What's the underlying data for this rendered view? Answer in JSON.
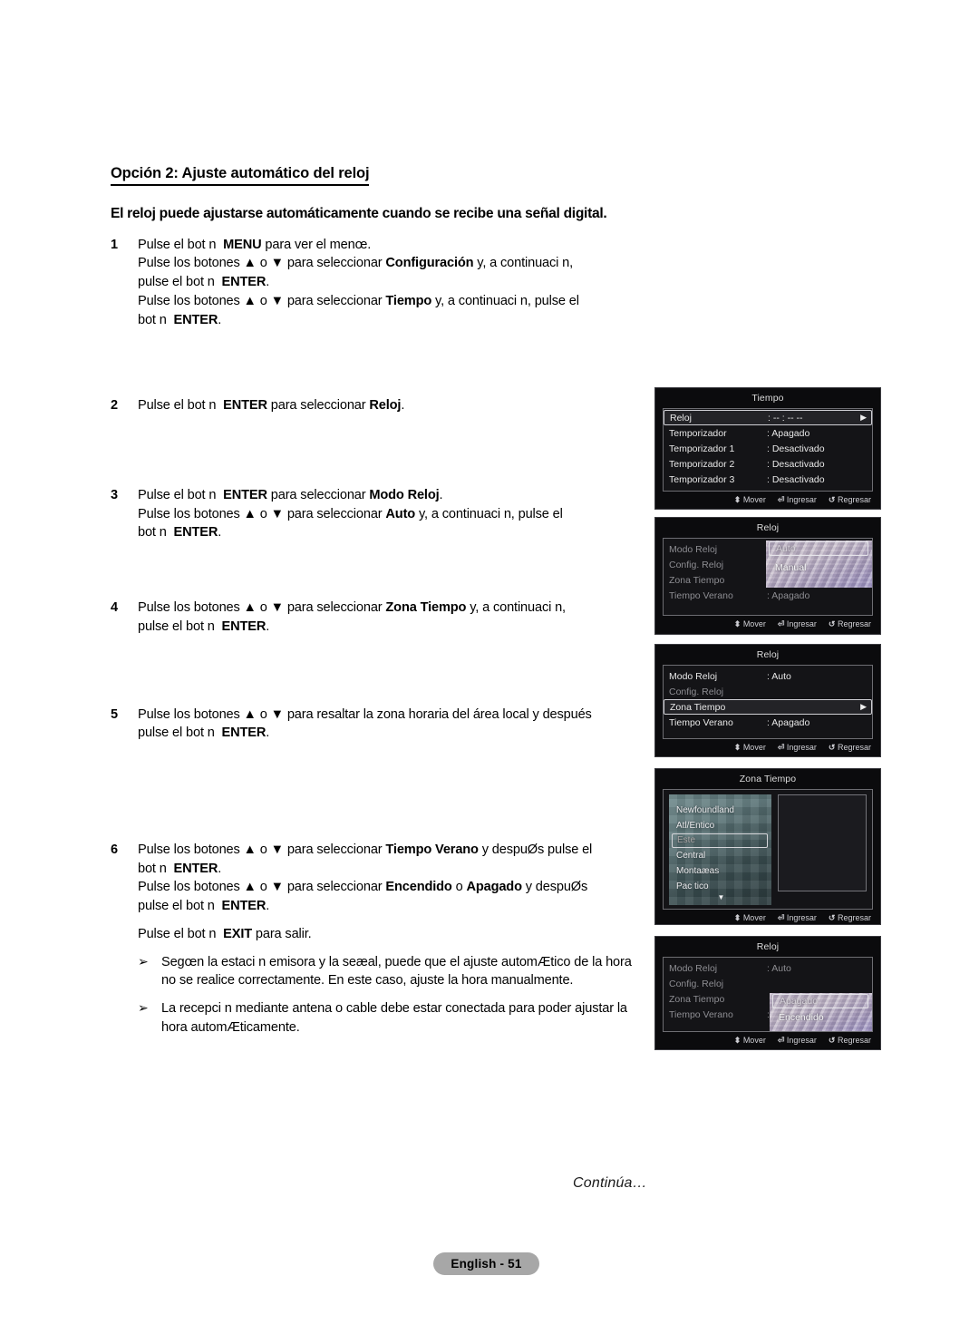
{
  "document": {
    "section_title": "Opción 2: Ajuste automático del reloj",
    "lead": "El reloj puede ajustarse automáticamente cuando se recibe una señal digital.",
    "continued_label": "Continúa…",
    "page_badge": "English - 51"
  },
  "steps": [
    {
      "number": "1",
      "lines": [
        "Pulse el bot n  MENU para ver el menœ.",
        "Pulse los botones ▲ o ▼ para seleccionar Configuración y, a continuaci n,",
        "pulse el bot n  ENTER.",
        "Pulse los botones ▲ o ▼ para seleccionar Tiempo y, a continuaci n, pulse el",
        "bot n  ENTER."
      ]
    },
    {
      "number": "2",
      "lines": [
        "Pulse el bot n  ENTER para seleccionar Reloj."
      ]
    },
    {
      "number": "3",
      "lines": [
        "Pulse el bot n  ENTER para seleccionar Modo Reloj.",
        "Pulse los botones ▲ o ▼ para seleccionar Auto y, a continuaci n, pulse el",
        "bot n  ENTER."
      ]
    },
    {
      "number": "4",
      "lines": [
        "Pulse los botones ▲ o ▼ para seleccionar Zona Tiempo y, a continuaci n,",
        "pulse el bot n  ENTER."
      ]
    },
    {
      "number": "5",
      "lines": [
        "Pulse los botones ▲ o ▼ para resaltar la zona horaria del área local y después",
        "pulse el bot n  ENTER."
      ]
    },
    {
      "number": "6",
      "lines": [
        "Pulse los botones ▲ o ▼ para seleccionar Tiempo Verano y despuØs pulse el",
        "bot n  ENTER.",
        "Pulse los botones ▲ o ▼ para seleccionar Encendido o Apagado y despuØs",
        "pulse el bot n  ENTER."
      ],
      "extra": "Pulse el bot n  EXIT para salir.",
      "bullets": [
        "Segœn la estaci n emisora y la seæal, puede que el ajuste automÆtico de la hora no se realice correctamente. En este caso, ajuste la hora manualmente.",
        "La recepci n mediante antena o cable debe estar conectada para poder ajustar la hora automÆticamente."
      ]
    }
  ],
  "inline_bold": {
    "menu": "MENU",
    "enter": "ENTER",
    "exit": "EXIT",
    "configuracion": "Configuración",
    "tiempo": "Tiempo",
    "reloj": "Reloj",
    "modo_reloj": "Modo Reloj",
    "auto": "Auto",
    "zona_tiempo": "Zona Tiempo",
    "tiempo_verano": "Tiempo Verano",
    "encendido": "Encendido",
    "apagado": "Apagado"
  },
  "osd_footer": {
    "move": "Mover",
    "enter": "Ingresar",
    "return": "Regresar",
    "move_icon": "updown-arrow-icon",
    "enter_icon": "enter-key-icon",
    "return_icon": "return-arrow-icon"
  },
  "screens": [
    {
      "id": "tiempo-menu",
      "title": "Tiempo",
      "rows": [
        {
          "label": "Reloj",
          "value": ": -- : -- --",
          "selected": true,
          "dim": false,
          "arrow": true
        },
        {
          "label": "Temporizador",
          "value": ": Apagado",
          "selected": false,
          "dim": false,
          "arrow": false
        },
        {
          "label": "Temporizador 1",
          "value": ": Desactivado",
          "selected": false,
          "dim": false,
          "arrow": false
        },
        {
          "label": "Temporizador 2",
          "value": ": Desactivado",
          "selected": false,
          "dim": false,
          "arrow": false
        },
        {
          "label": "Temporizador 3",
          "value": ": Desactivado",
          "selected": false,
          "dim": false,
          "arrow": false
        }
      ]
    },
    {
      "id": "reloj-modo-menu",
      "title": "Reloj",
      "rows": [
        {
          "label": "Modo Reloj",
          "value": ":",
          "selected": false,
          "dim": true,
          "arrow": false
        },
        {
          "label": "Config. Reloj",
          "value": "",
          "selected": false,
          "dim": true,
          "arrow": false
        },
        {
          "label": "Zona Tiempo",
          "value": "",
          "selected": false,
          "dim": true,
          "arrow": false
        },
        {
          "label": "Tiempo Verano",
          "value": ": Apagado",
          "selected": false,
          "dim": true,
          "arrow": false
        }
      ],
      "popup": {
        "options": [
          "Auto",
          "Manual"
        ],
        "highlighted": "Auto"
      }
    },
    {
      "id": "reloj-zona-menu",
      "title": "Reloj",
      "rows": [
        {
          "label": "Modo Reloj",
          "value": ": Auto",
          "selected": false,
          "dim": false,
          "arrow": false
        },
        {
          "label": "Config. Reloj",
          "value": "",
          "selected": false,
          "dim": true,
          "arrow": false
        },
        {
          "label": "Zona Tiempo",
          "value": "",
          "selected": true,
          "dim": false,
          "arrow": true
        },
        {
          "label": "Tiempo Verano",
          "value": ": Apagado",
          "selected": false,
          "dim": false,
          "arrow": false
        }
      ]
    },
    {
      "id": "zona-tiempo-menu",
      "title": "Zona Tiempo",
      "zones": [
        "Newfoundland",
        "Atl/Entico",
        "Este",
        "Central",
        "Montaæas",
        "Pac tico"
      ],
      "highlighted_zone": "Este",
      "scroll_indicator": "▼"
    },
    {
      "id": "reloj-verano-menu",
      "title": "Reloj",
      "rows": [
        {
          "label": "Modo Reloj",
          "value": ": Auto",
          "selected": false,
          "dim": true,
          "arrow": false
        },
        {
          "label": "Config. Reloj",
          "value": "",
          "selected": false,
          "dim": true,
          "arrow": false
        },
        {
          "label": "Zona Tiempo",
          "value": "",
          "selected": false,
          "dim": true,
          "arrow": false
        },
        {
          "label": "Tiempo Verano",
          "value": ":",
          "selected": false,
          "dim": true,
          "arrow": false
        }
      ],
      "popup": {
        "options": [
          "Apagado",
          "Encendido"
        ],
        "highlighted": "Apagado"
      }
    }
  ]
}
